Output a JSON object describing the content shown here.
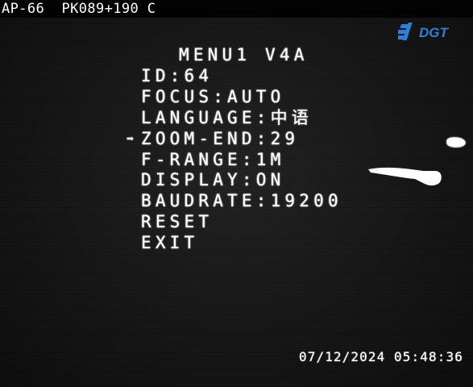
{
  "camera": {
    "label": "AP-66  PK089+190 C"
  },
  "logo": {
    "text": "DGT",
    "color": "#2c7fd8"
  },
  "osd_menu": {
    "title": "MENU1 V4A",
    "cursor_icon": "arrow-right-icon",
    "selected_index": 3,
    "items": [
      {
        "label": "ID:64"
      },
      {
        "label": "FOCUS:AUTO"
      },
      {
        "label": "LANGUAGE:中语"
      },
      {
        "label": "ZOOM-END:29"
      },
      {
        "label": "F-RANGE:1M"
      },
      {
        "label": "DISPLAY:ON"
      },
      {
        "label": "BAUDRATE:19200"
      },
      {
        "label": "RESET"
      },
      {
        "label": "EXIT"
      }
    ]
  },
  "timestamp": "07/12/2024 05:48:36",
  "colors": {
    "background": "#141414",
    "text": "#ffffff"
  }
}
